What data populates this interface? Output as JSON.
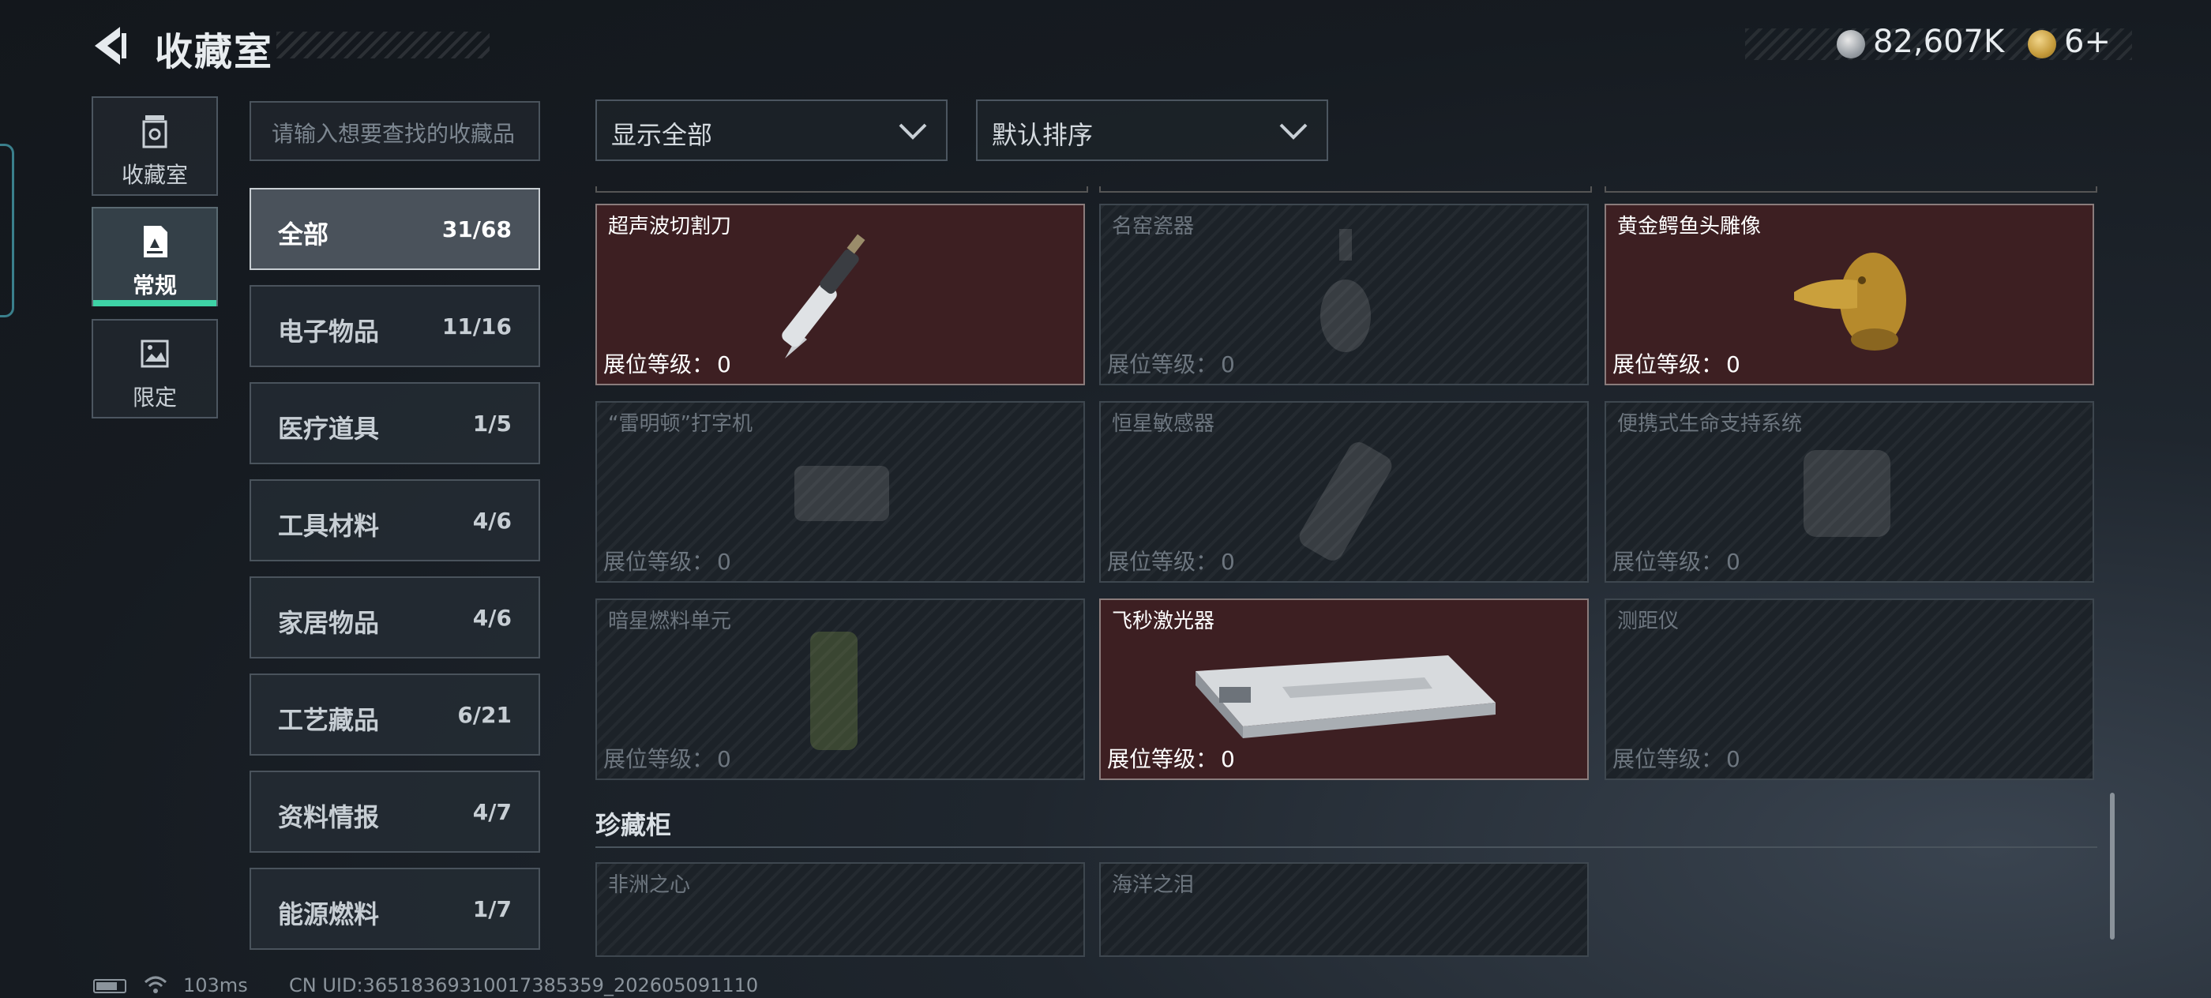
{
  "header": {
    "title": "收藏室"
  },
  "currency": [
    {
      "icon": "silver-coin-icon",
      "value": "82,607K"
    },
    {
      "icon": "gold-coin-icon",
      "value": "6+"
    }
  ],
  "mode_tabs": [
    {
      "label": "收藏室",
      "icon": "vault-icon",
      "active": false
    },
    {
      "label": "常规",
      "icon": "document-icon",
      "active": true
    },
    {
      "label": "限定",
      "icon": "picture-icon",
      "active": false
    }
  ],
  "search": {
    "placeholder": "请输入想要查找的收藏品"
  },
  "categories": [
    {
      "name": "全部",
      "count": "31/68",
      "active": true
    },
    {
      "name": "电子物品",
      "count": "11/16"
    },
    {
      "name": "医疗道具",
      "count": "1/5"
    },
    {
      "name": "工具材料",
      "count": "4/6"
    },
    {
      "name": "家居物品",
      "count": "4/6"
    },
    {
      "name": "工艺藏品",
      "count": "6/21"
    },
    {
      "name": "资料情报",
      "count": "4/7"
    },
    {
      "name": "能源燃料",
      "count": "1/7"
    }
  ],
  "filters": {
    "display": "显示全部",
    "sort": "默认排序"
  },
  "level_label": "展位等级：",
  "items": [
    {
      "name": "超声波切割刀",
      "level": "0",
      "owned": true
    },
    {
      "name": "名窑瓷器",
      "level": "0",
      "owned": false
    },
    {
      "name": "黄金鳄鱼头雕像",
      "level": "0",
      "owned": true
    },
    {
      "name": "“雷明顿”打字机",
      "level": "0",
      "owned": false
    },
    {
      "name": "恒星敏感器",
      "level": "0",
      "owned": false
    },
    {
      "name": "便携式生命支持系统",
      "level": "0",
      "owned": false
    },
    {
      "name": "暗星燃料单元",
      "level": "0",
      "owned": false
    },
    {
      "name": "飞秒激光器",
      "level": "0",
      "owned": true
    },
    {
      "name": "测距仪",
      "level": "0",
      "owned": false
    }
  ],
  "section2": {
    "title": "珍藏柜",
    "items": [
      {
        "name": "非洲之心",
        "owned": false
      },
      {
        "name": "海洋之泪",
        "owned": false
      }
    ]
  },
  "status": {
    "ping": "103ms",
    "uid": "CN UID:3651836931001738535​9_202605091110"
  }
}
